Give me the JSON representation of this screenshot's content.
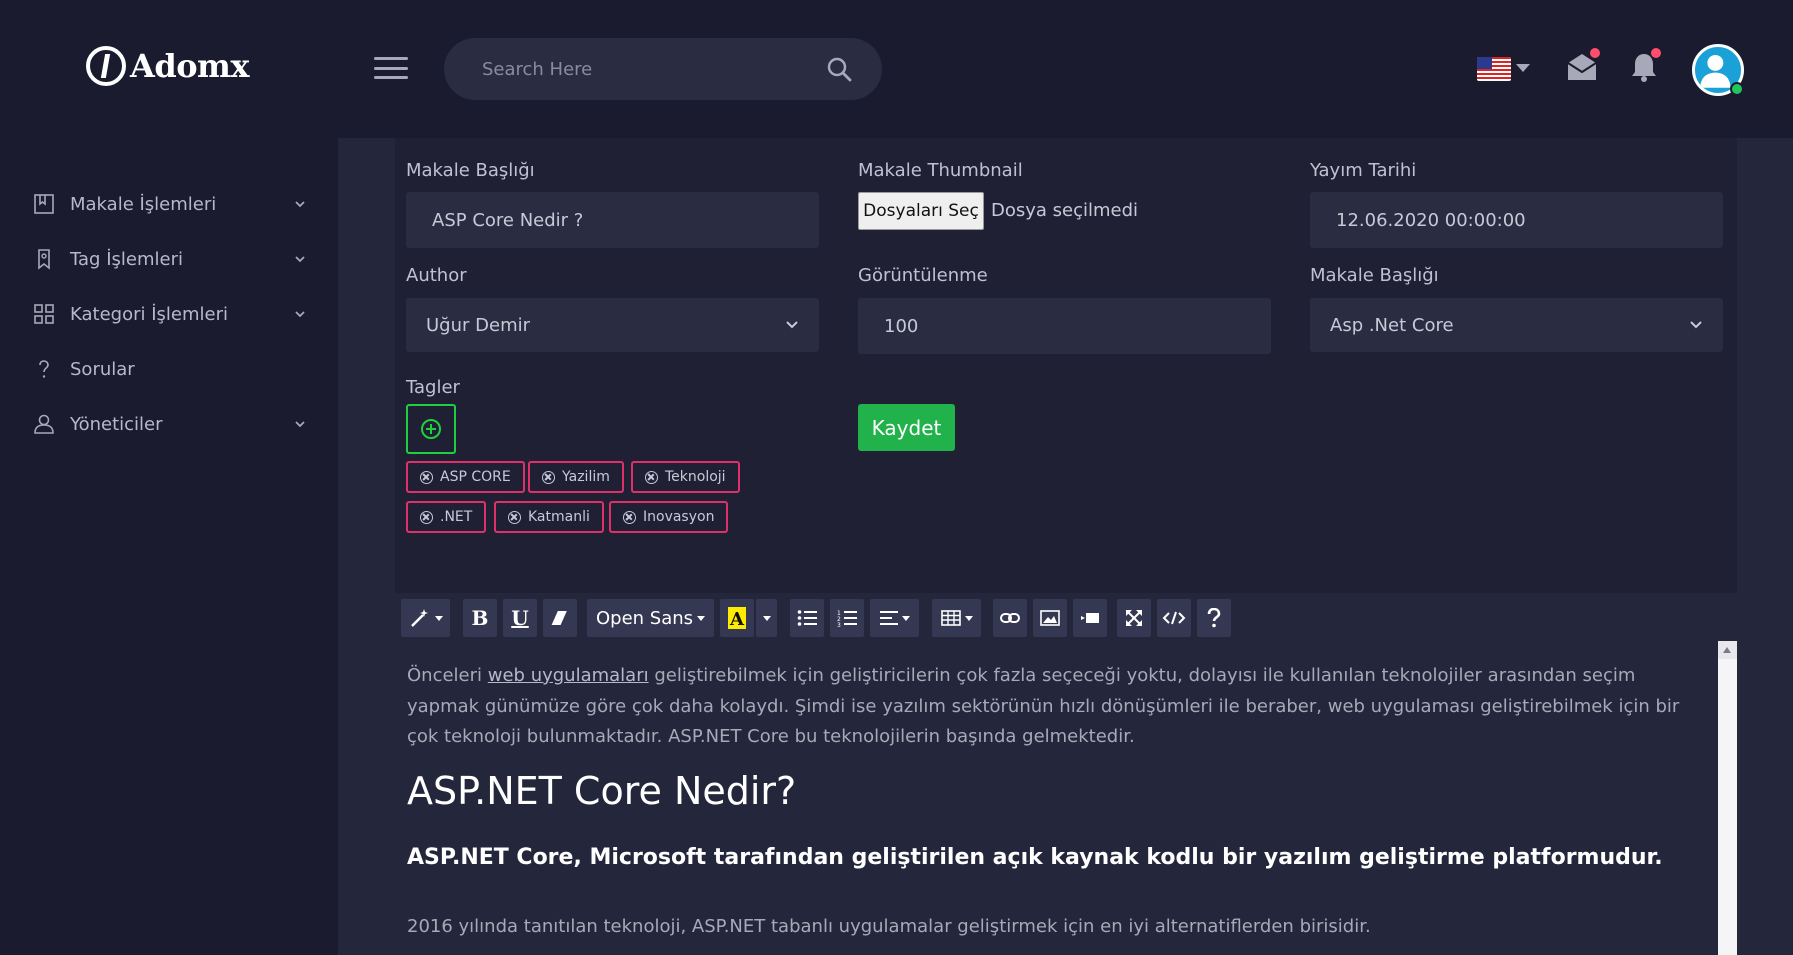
{
  "header": {
    "logo_text": "Adomx",
    "search_placeholder": "Search Here"
  },
  "sidebar": {
    "items": [
      {
        "label": "Makale İşlemleri",
        "icon": "book-icon",
        "has_children": true
      },
      {
        "label": "Tag İşlemleri",
        "icon": "bookmark-icon",
        "has_children": true
      },
      {
        "label": "Kategori İşlemleri",
        "icon": "grid-icon",
        "has_children": true
      },
      {
        "label": "Sorular",
        "icon": "question-icon",
        "has_children": false
      },
      {
        "label": "Yöneticiler",
        "icon": "user-icon",
        "has_children": true
      }
    ]
  },
  "form": {
    "title_label": "Makale Başlığı",
    "title_value": "ASP Core Nedir ?",
    "thumbnail_label": "Makale Thumbnail",
    "file_button": "Dosyaları Seç",
    "file_status": "Dosya seçilmedi",
    "date_label": "Yayım Tarihi",
    "date_value": "12.06.2020 00:00:00",
    "author_label": "Author",
    "author_value": "Uğur Demir",
    "views_label": "Görüntülenme",
    "views_value": "100",
    "category_label": "Makale Başlığı",
    "category_value": "Asp .Net Core",
    "tags_label": "Tagler",
    "tags": [
      "ASP CORE",
      "Yazilim",
      "Teknoloji",
      ".NET",
      "Katmanli",
      "Inovasyon"
    ],
    "save_label": "Kaydet"
  },
  "editor": {
    "font_name": "Open Sans",
    "paragraph1_pre": "Önceleri ",
    "paragraph1_link": "web uygulamaları",
    "paragraph1_post": " geliştirebilmek için geliştiricilerin çok fazla seçeceği yoktu, dolayısı ile kullanılan teknolojiler arasından seçim yapmak günümüze göre çok daha kolaydı. Şimdi ise yazılım sektörünün hızlı dönüşümleri ile beraber, web uygulaması geliştirebilmek için bir çok teknoloji bulunmaktadır. ASP.NET Core bu teknolojilerin başında gelmektedir.",
    "heading1": "ASP.NET Core Nedir?",
    "heading2": "ASP.NET Core, Microsoft tarafından geliştirilen açık kaynak kodlu bir yazılım geliştirme platformudur.",
    "paragraph2": "2016 yılında tanıtılan teknoloji, ASP.NET tabanlı uygulamalar geliştirmek için en iyi alternatiflerden birisidir."
  },
  "colors": {
    "bg": "#1a1b2e",
    "panel": "#24263b",
    "input": "#2a2c42",
    "accent_green": "#22b24c",
    "tag_border": "#e0306a"
  }
}
